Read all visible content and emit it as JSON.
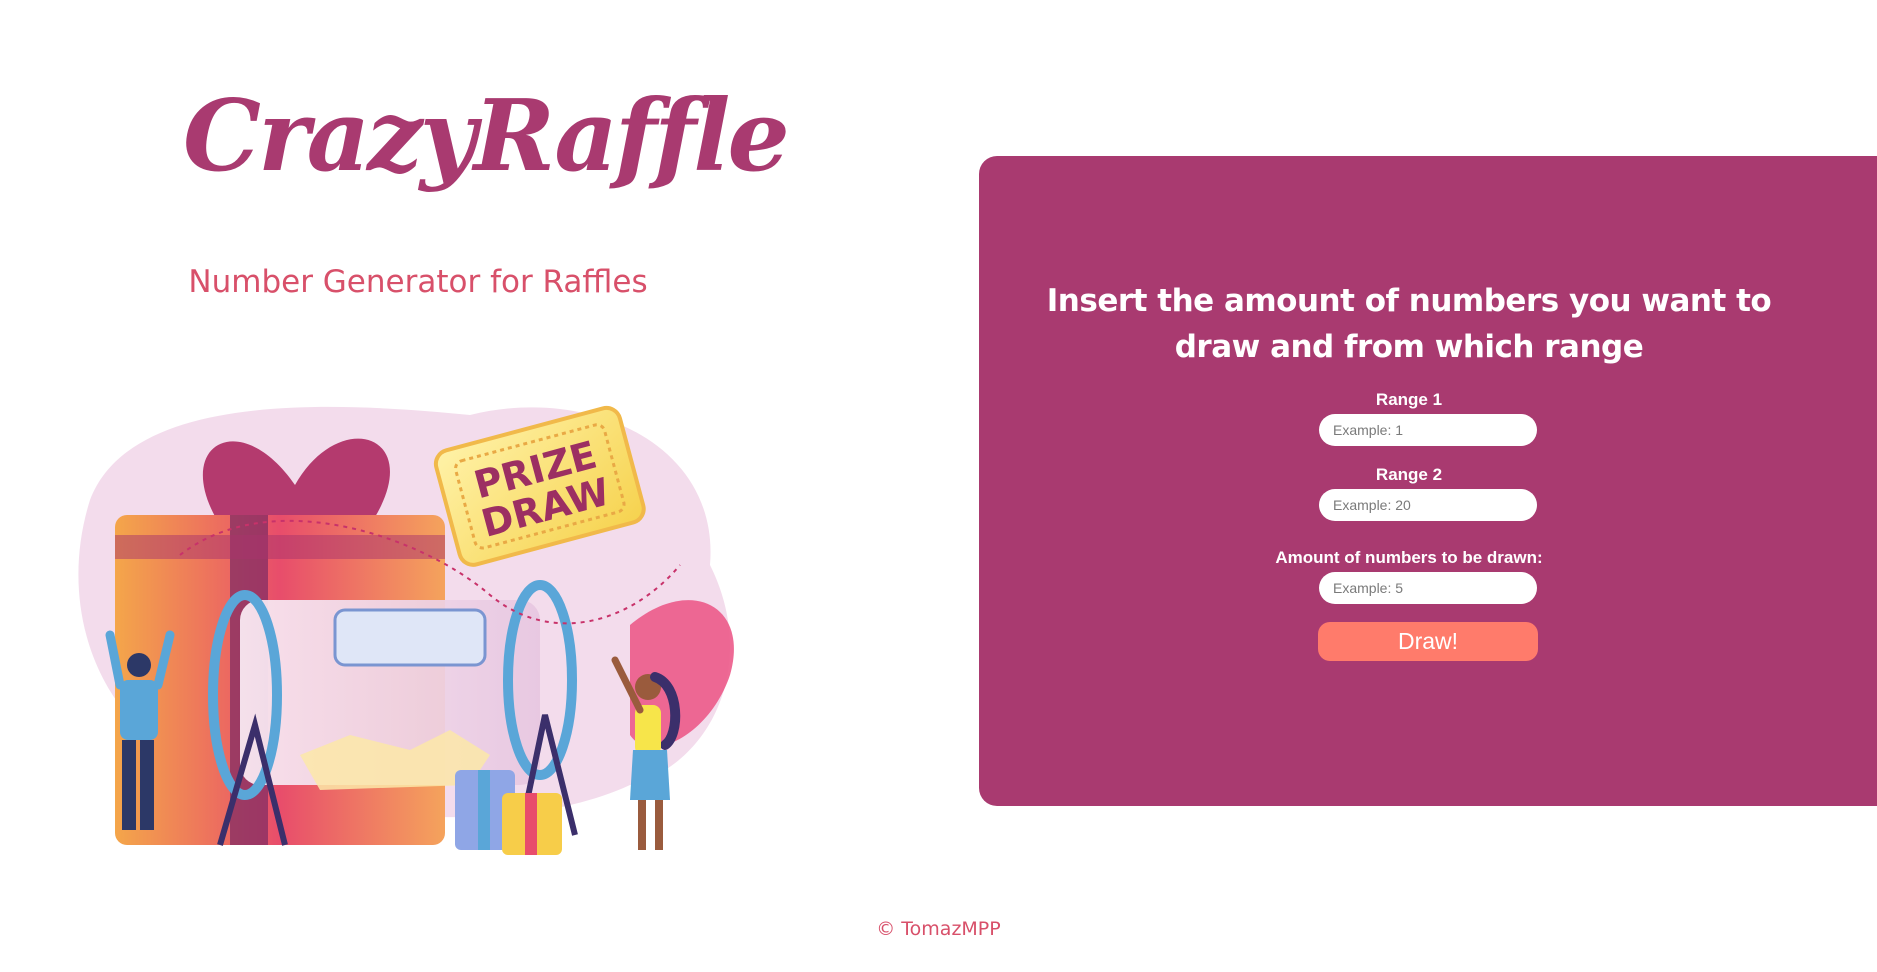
{
  "header": {
    "brand": "CrazyRaffle",
    "tagline": "Number Generator for Raffles"
  },
  "illustration": {
    "ticket_line1": "PRIZE",
    "ticket_line2": "DRAW"
  },
  "form": {
    "prompt": "Insert the amount of numbers you want to draw and from which range",
    "range1": {
      "label": "Range 1",
      "placeholder": "Example: 1",
      "value": ""
    },
    "range2": {
      "label": "Range 2",
      "placeholder": "Example: 20",
      "value": ""
    },
    "amount": {
      "label": "Amount of numbers to be drawn:",
      "placeholder": "Example: 5",
      "value": ""
    },
    "draw_label": "Draw!"
  },
  "footer": {
    "text": "© TomazMPP"
  },
  "colors": {
    "brand": "#a93a70",
    "tagline": "#d8506a",
    "button": "#ff7b6b",
    "panel": "#a93a70"
  }
}
